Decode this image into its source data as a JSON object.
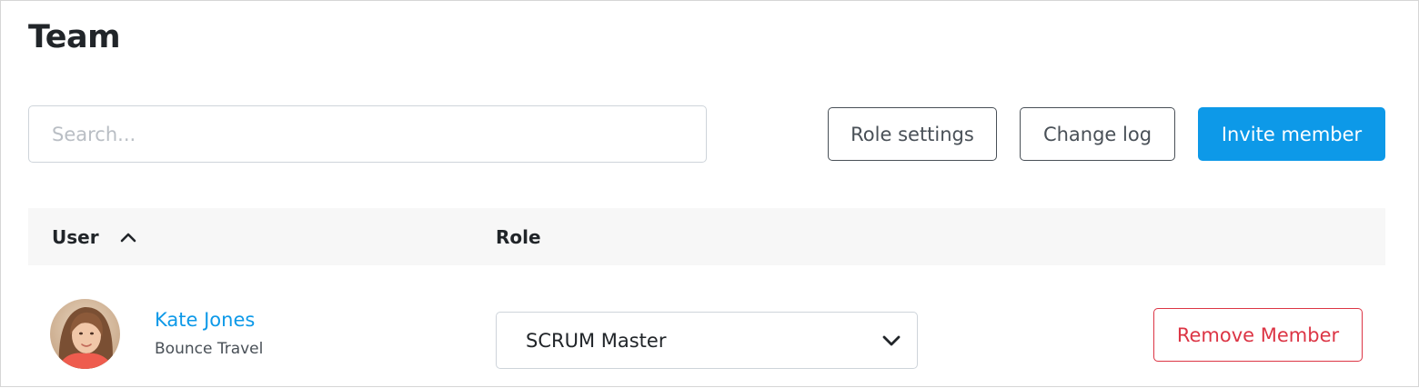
{
  "page": {
    "title": "Team"
  },
  "toolbar": {
    "search_placeholder": "Search...",
    "role_settings_label": "Role settings",
    "change_log_label": "Change log",
    "invite_label": "Invite member",
    "accent_color": "#0d99e8"
  },
  "table": {
    "columns": [
      "User",
      "Role"
    ],
    "sort": {
      "column": "User",
      "direction": "ascending",
      "icon": "chevron-up-icon"
    },
    "rows": [
      {
        "avatar": "user-photo",
        "name": "Kate Jones",
        "company": "Bounce Travel",
        "role": "SCRUM Master",
        "remove_label": "Remove Member"
      }
    ]
  }
}
